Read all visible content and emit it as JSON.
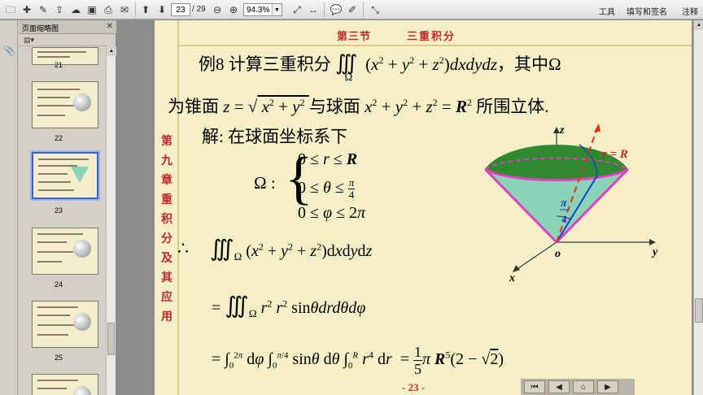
{
  "toolbar": {
    "page_current": "23",
    "page_total": "/ 29",
    "zoom": "94.3%",
    "tools_label": "工具",
    "fill_sign_label": "填写和签名",
    "comment_label": "注释"
  },
  "sidebar": {
    "panel_title": "页面缩略图",
    "thumbnails": [
      {
        "label": "21"
      },
      {
        "label": "22"
      },
      {
        "label": "23"
      },
      {
        "label": "24"
      },
      {
        "label": "25"
      }
    ]
  },
  "slide": {
    "section_title": "第三节",
    "section_name": "三重积分",
    "chapter_label": "第九章 重积分及其应用",
    "example_label": "例8",
    "problem_lead": "计算三重积分",
    "problem_tail": "，其中Ω",
    "problem_line2a": "为锥面",
    "problem_line2b": "与球面",
    "problem_line2c": "所围立体.",
    "solution_label": "解:",
    "solution_text": "在球面坐标系下",
    "omega_label": "Ω :",
    "therefore": "∴",
    "figure_label_r": "r = R",
    "figure_axis_z": "z",
    "figure_axis_y": "y",
    "figure_axis_x": "x",
    "figure_origin": "o",
    "page_number": "- 23 -"
  },
  "colors": {
    "slide_bg": "#f5eec6",
    "accent_red": "#c1272d",
    "cone_green": "#8ad3b8",
    "cap_green": "#2f8a2f",
    "cone_edge": "#e040c0"
  }
}
